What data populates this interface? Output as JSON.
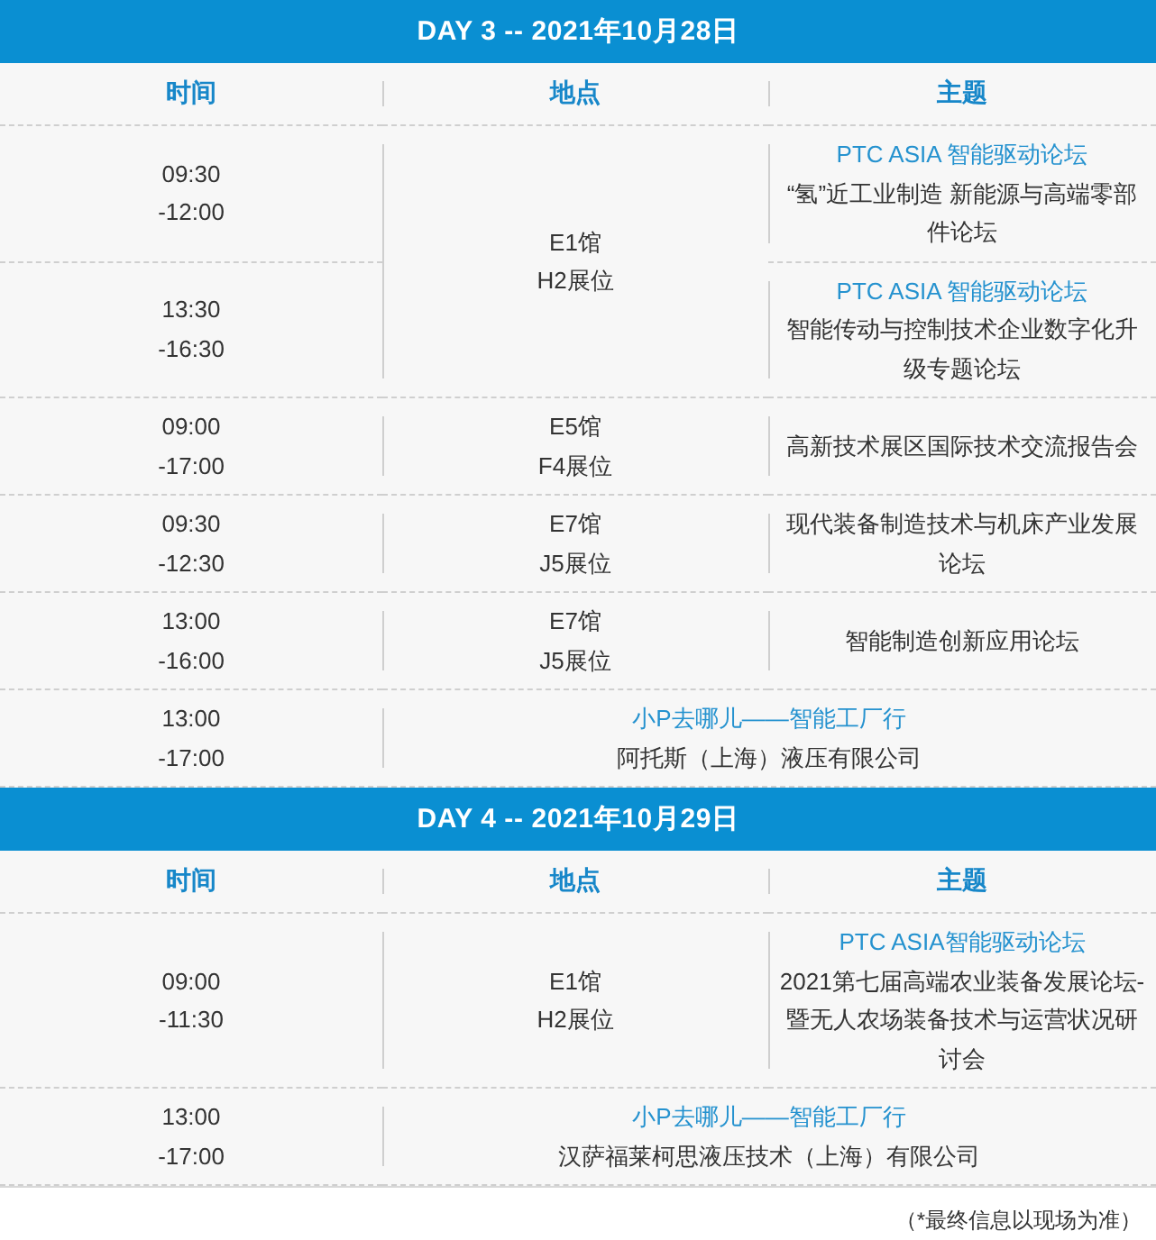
{
  "days": [
    {
      "title": "DAY 3 -- 2021年10月28日",
      "columns": [
        "时间",
        "地点",
        "主题"
      ],
      "rows": [
        {
          "kind": "shared",
          "location": [
            "E1馆",
            "H2展位"
          ],
          "sessions": [
            {
              "time": [
                "09:30",
                "-12:00"
              ],
              "title": "PTC ASIA 智能驱动论坛",
              "topic": "“氢”近工业制造 新能源与高端零部件论坛"
            },
            {
              "time": [
                "13:30",
                "-16:30"
              ],
              "title": "PTC ASIA 智能驱动论坛",
              "topic": "智能传动与控制技术企业数字化升级专题论坛"
            }
          ]
        },
        {
          "kind": "session",
          "time": [
            "09:00",
            "-17:00"
          ],
          "location": [
            "E5馆",
            "F4展位"
          ],
          "topic": "高新技术展区国际技术交流报告会"
        },
        {
          "kind": "session",
          "time": [
            "09:30",
            "-12:30"
          ],
          "location": [
            "E7馆",
            "J5展位"
          ],
          "topic": "现代装备制造技术与机床产业发展论坛"
        },
        {
          "kind": "session",
          "time": [
            "13:00",
            "-16:00"
          ],
          "location": [
            "E7馆",
            "J5展位"
          ],
          "topic": "智能制造创新应用论坛"
        },
        {
          "kind": "visit",
          "time": [
            "13:00",
            "-17:00"
          ],
          "title": "小P去哪儿——智能工厂行",
          "company": "阿托斯（上海）液压有限公司"
        }
      ]
    },
    {
      "title": "DAY 4 -- 2021年10月29日",
      "columns": [
        "时间",
        "地点",
        "主题"
      ],
      "rows": [
        {
          "kind": "session",
          "time": [
            "09:00",
            "-11:30"
          ],
          "location": [
            "E1馆",
            "H2展位"
          ],
          "title": "PTC ASIA智能驱动论坛",
          "topic": "2021第七届高端农业装备发展论坛-暨无人农场装备技术与运营状况研讨会"
        },
        {
          "kind": "visit",
          "time": [
            "13:00",
            "-17:00"
          ],
          "title": "小P去哪儿——智能工厂行",
          "company": "汉萨福莱柯思液压技术（上海）有限公司"
        }
      ]
    }
  ],
  "footnote": "（*最终信息以现场为准）"
}
